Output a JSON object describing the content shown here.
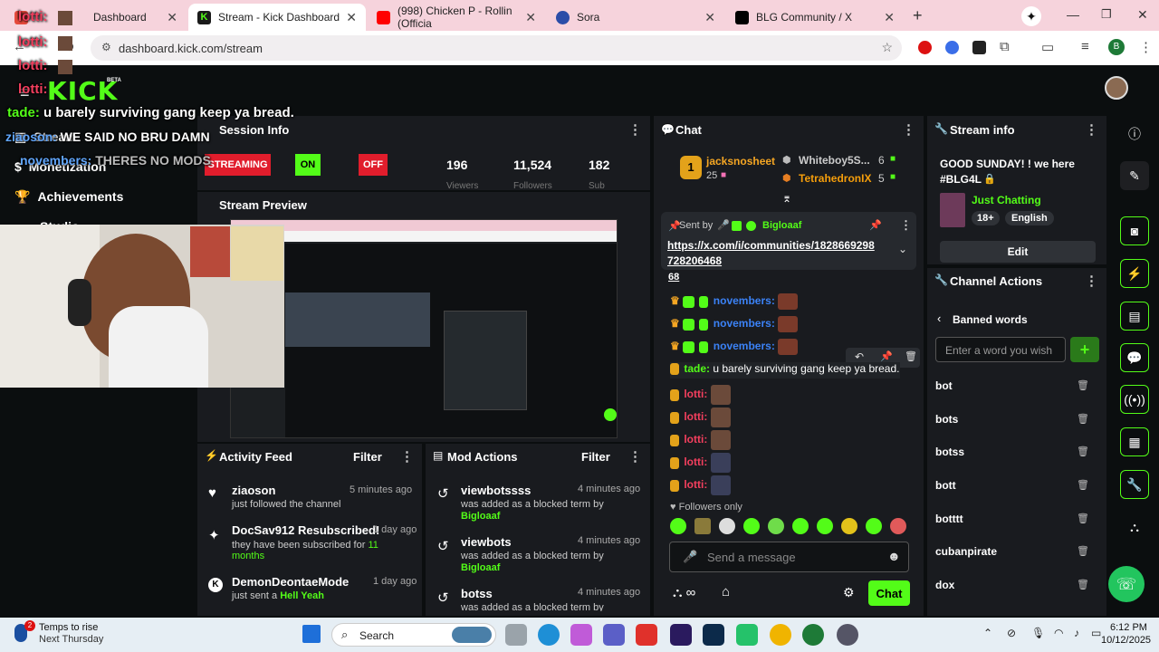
{
  "browser": {
    "tabs": [
      {
        "label": "Dashboard",
        "icon_color": "#e64a3c",
        "active": false
      },
      {
        "label": "Stream - Kick Dashboard",
        "icon_color": "#1a1a1a",
        "active": true
      },
      {
        "label": "(998) Chicken P - Rollin (Officia",
        "icon_color": "#ff0000",
        "active": false
      },
      {
        "label": "Sora",
        "icon_color": "#2b4da8",
        "active": false
      },
      {
        "label": "BLG Community / X",
        "icon_color": "#000000",
        "active": false
      }
    ],
    "url": "dashboard.kick.com/stream",
    "profile_initial": "B"
  },
  "overlay": {
    "chat_lines": [
      {
        "user": "lotti:",
        "text": ""
      },
      {
        "user": "lotti:",
        "text": ""
      },
      {
        "user": "lotti:",
        "text": ""
      },
      {
        "user": "lotti:",
        "text": ""
      },
      {
        "user": "tade:",
        "text": "u barely surviving gang keep ya bread."
      },
      {
        "user": "ziaoson:",
        "text": "WE SAID NO BRU DAMN"
      },
      {
        "user": "novembers:",
        "text": "THERES NO MODS"
      }
    ]
  },
  "kick": {
    "logo": "KICK",
    "logo_tag": "BETA",
    "sidebar": [
      {
        "label": "Stream"
      },
      {
        "label": "Monetization"
      },
      {
        "label": "Achievements"
      },
      {
        "label": "Studio"
      }
    ],
    "session": {
      "title": "Session Info",
      "streaming_label": "STREAMING",
      "on_label": "ON",
      "off_label": "OFF",
      "stats": [
        {
          "value": "196",
          "label": "Viewers"
        },
        {
          "value": "11,524",
          "label": "Followers"
        },
        {
          "value": "182",
          "label": "Sub"
        }
      ]
    },
    "preview_title": "Stream Preview",
    "activity": {
      "title": "Activity Feed",
      "filter": "Filter",
      "items": [
        {
          "name": "ziaoson",
          "time": "5 minutes ago",
          "sub": "just followed the channel",
          "extra": ""
        },
        {
          "name": "DocSav912 Resubscribed!",
          "time": "1 day ago",
          "sub": "they have been subscribed for",
          "extra": "11 months"
        },
        {
          "name": "DemonDeontaeMode",
          "time": "1 day ago",
          "sub": "just sent a",
          "extra": "Hell Yeah"
        }
      ]
    },
    "modactions": {
      "title": "Mod Actions",
      "filter": "Filter",
      "items": [
        {
          "term": "viewbotssss",
          "time": "4 minutes ago",
          "sub": "was added as a blocked term by",
          "by": "Bigloaaf"
        },
        {
          "term": "viewbots",
          "time": "4 minutes ago",
          "sub": "was added as a blocked term by",
          "by": "Bigloaaf"
        },
        {
          "term": "botss",
          "time": "4 minutes ago",
          "sub": "was added as a blocked term by",
          "by": ""
        }
      ]
    },
    "chat": {
      "title": "Chat",
      "leaderboard": [
        {
          "rank": "1",
          "name": "jacksnosheet",
          "count": "25"
        },
        {
          "name": "Whiteboy5S...",
          "count": "6"
        },
        {
          "name": "TetrahedronIX",
          "count": "5"
        }
      ],
      "pinned": {
        "sent_by_label": "Sent by",
        "sender": "Bigloaaf",
        "link": "https://x.com/i/communities/1828669298728206468",
        "link_line1": "https://x.com/i/communities/1828669298",
        "link_line2": "728206468"
      },
      "partial_number": "68",
      "messages": [
        {
          "user": "novembers:",
          "color": "#3b82f6"
        },
        {
          "user": "novembers:",
          "color": "#3b82f6"
        },
        {
          "user": "novembers:",
          "color": "#3b82f6"
        },
        {
          "user": "tade:",
          "text": "u barely surviving gang keep ya bread.",
          "color": "#53fc18"
        },
        {
          "user": "lotti:",
          "color": "#f43f5e"
        },
        {
          "user": "lotti:",
          "color": "#f43f5e"
        },
        {
          "user": "lotti:",
          "color": "#f43f5e"
        },
        {
          "user": "lotti:",
          "color": "#f43f5e"
        },
        {
          "user": "lotti:",
          "color": "#f43f5e"
        }
      ],
      "followers_only": "Followers only",
      "placeholder": "Send a message",
      "send_label": "Chat"
    },
    "stream_info": {
      "title": "Stream info",
      "stream_title_line1": "GOOD SUNDAY! ! we here",
      "stream_title_line2": "#BLG4L",
      "category": "Just Chatting",
      "tags": [
        "18+",
        "English"
      ],
      "edit_label": "Edit"
    },
    "channel_actions": {
      "title": "Channel Actions",
      "back_label": "Banned words",
      "input_placeholder": "Enter a word you wish",
      "words": [
        "bot",
        "bots",
        "botss",
        "bott",
        "botttt",
        "cubanpirate",
        "dox"
      ]
    }
  },
  "taskbar": {
    "weather_title": "Temps to rise",
    "weather_sub": "Next Thursday",
    "weather_badge": "2",
    "search_label": "Search",
    "time": "6:12 PM",
    "date": "10/12/2025"
  }
}
